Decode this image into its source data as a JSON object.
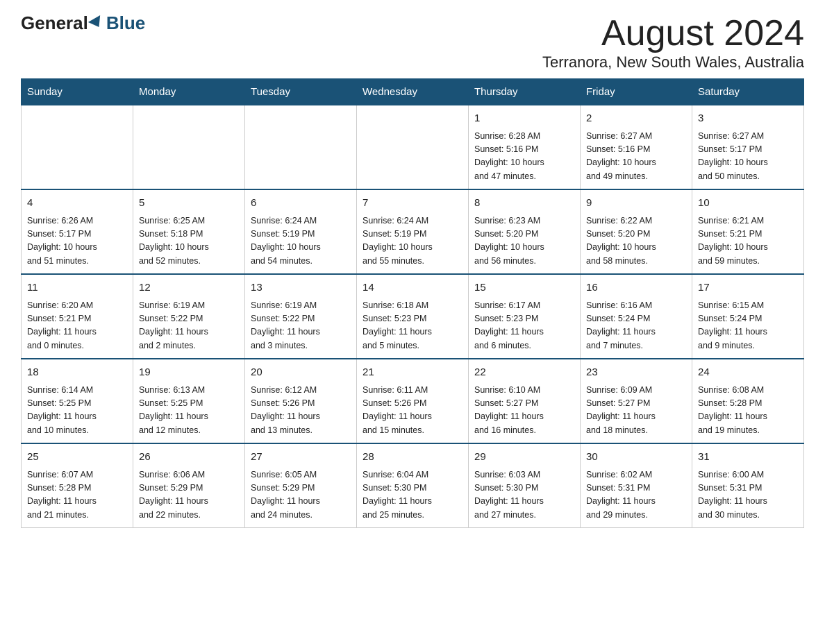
{
  "header": {
    "logo_general": "General",
    "logo_blue": "Blue",
    "page_title": "August 2024",
    "location": "Terranora, New South Wales, Australia"
  },
  "days_of_week": [
    "Sunday",
    "Monday",
    "Tuesday",
    "Wednesday",
    "Thursday",
    "Friday",
    "Saturday"
  ],
  "weeks": [
    [
      {
        "day": "",
        "info": ""
      },
      {
        "day": "",
        "info": ""
      },
      {
        "day": "",
        "info": ""
      },
      {
        "day": "",
        "info": ""
      },
      {
        "day": "1",
        "info": "Sunrise: 6:28 AM\nSunset: 5:16 PM\nDaylight: 10 hours\nand 47 minutes."
      },
      {
        "day": "2",
        "info": "Sunrise: 6:27 AM\nSunset: 5:16 PM\nDaylight: 10 hours\nand 49 minutes."
      },
      {
        "day": "3",
        "info": "Sunrise: 6:27 AM\nSunset: 5:17 PM\nDaylight: 10 hours\nand 50 minutes."
      }
    ],
    [
      {
        "day": "4",
        "info": "Sunrise: 6:26 AM\nSunset: 5:17 PM\nDaylight: 10 hours\nand 51 minutes."
      },
      {
        "day": "5",
        "info": "Sunrise: 6:25 AM\nSunset: 5:18 PM\nDaylight: 10 hours\nand 52 minutes."
      },
      {
        "day": "6",
        "info": "Sunrise: 6:24 AM\nSunset: 5:19 PM\nDaylight: 10 hours\nand 54 minutes."
      },
      {
        "day": "7",
        "info": "Sunrise: 6:24 AM\nSunset: 5:19 PM\nDaylight: 10 hours\nand 55 minutes."
      },
      {
        "day": "8",
        "info": "Sunrise: 6:23 AM\nSunset: 5:20 PM\nDaylight: 10 hours\nand 56 minutes."
      },
      {
        "day": "9",
        "info": "Sunrise: 6:22 AM\nSunset: 5:20 PM\nDaylight: 10 hours\nand 58 minutes."
      },
      {
        "day": "10",
        "info": "Sunrise: 6:21 AM\nSunset: 5:21 PM\nDaylight: 10 hours\nand 59 minutes."
      }
    ],
    [
      {
        "day": "11",
        "info": "Sunrise: 6:20 AM\nSunset: 5:21 PM\nDaylight: 11 hours\nand 0 minutes."
      },
      {
        "day": "12",
        "info": "Sunrise: 6:19 AM\nSunset: 5:22 PM\nDaylight: 11 hours\nand 2 minutes."
      },
      {
        "day": "13",
        "info": "Sunrise: 6:19 AM\nSunset: 5:22 PM\nDaylight: 11 hours\nand 3 minutes."
      },
      {
        "day": "14",
        "info": "Sunrise: 6:18 AM\nSunset: 5:23 PM\nDaylight: 11 hours\nand 5 minutes."
      },
      {
        "day": "15",
        "info": "Sunrise: 6:17 AM\nSunset: 5:23 PM\nDaylight: 11 hours\nand 6 minutes."
      },
      {
        "day": "16",
        "info": "Sunrise: 6:16 AM\nSunset: 5:24 PM\nDaylight: 11 hours\nand 7 minutes."
      },
      {
        "day": "17",
        "info": "Sunrise: 6:15 AM\nSunset: 5:24 PM\nDaylight: 11 hours\nand 9 minutes."
      }
    ],
    [
      {
        "day": "18",
        "info": "Sunrise: 6:14 AM\nSunset: 5:25 PM\nDaylight: 11 hours\nand 10 minutes."
      },
      {
        "day": "19",
        "info": "Sunrise: 6:13 AM\nSunset: 5:25 PM\nDaylight: 11 hours\nand 12 minutes."
      },
      {
        "day": "20",
        "info": "Sunrise: 6:12 AM\nSunset: 5:26 PM\nDaylight: 11 hours\nand 13 minutes."
      },
      {
        "day": "21",
        "info": "Sunrise: 6:11 AM\nSunset: 5:26 PM\nDaylight: 11 hours\nand 15 minutes."
      },
      {
        "day": "22",
        "info": "Sunrise: 6:10 AM\nSunset: 5:27 PM\nDaylight: 11 hours\nand 16 minutes."
      },
      {
        "day": "23",
        "info": "Sunrise: 6:09 AM\nSunset: 5:27 PM\nDaylight: 11 hours\nand 18 minutes."
      },
      {
        "day": "24",
        "info": "Sunrise: 6:08 AM\nSunset: 5:28 PM\nDaylight: 11 hours\nand 19 minutes."
      }
    ],
    [
      {
        "day": "25",
        "info": "Sunrise: 6:07 AM\nSunset: 5:28 PM\nDaylight: 11 hours\nand 21 minutes."
      },
      {
        "day": "26",
        "info": "Sunrise: 6:06 AM\nSunset: 5:29 PM\nDaylight: 11 hours\nand 22 minutes."
      },
      {
        "day": "27",
        "info": "Sunrise: 6:05 AM\nSunset: 5:29 PM\nDaylight: 11 hours\nand 24 minutes."
      },
      {
        "day": "28",
        "info": "Sunrise: 6:04 AM\nSunset: 5:30 PM\nDaylight: 11 hours\nand 25 minutes."
      },
      {
        "day": "29",
        "info": "Sunrise: 6:03 AM\nSunset: 5:30 PM\nDaylight: 11 hours\nand 27 minutes."
      },
      {
        "day": "30",
        "info": "Sunrise: 6:02 AM\nSunset: 5:31 PM\nDaylight: 11 hours\nand 29 minutes."
      },
      {
        "day": "31",
        "info": "Sunrise: 6:00 AM\nSunset: 5:31 PM\nDaylight: 11 hours\nand 30 minutes."
      }
    ]
  ]
}
